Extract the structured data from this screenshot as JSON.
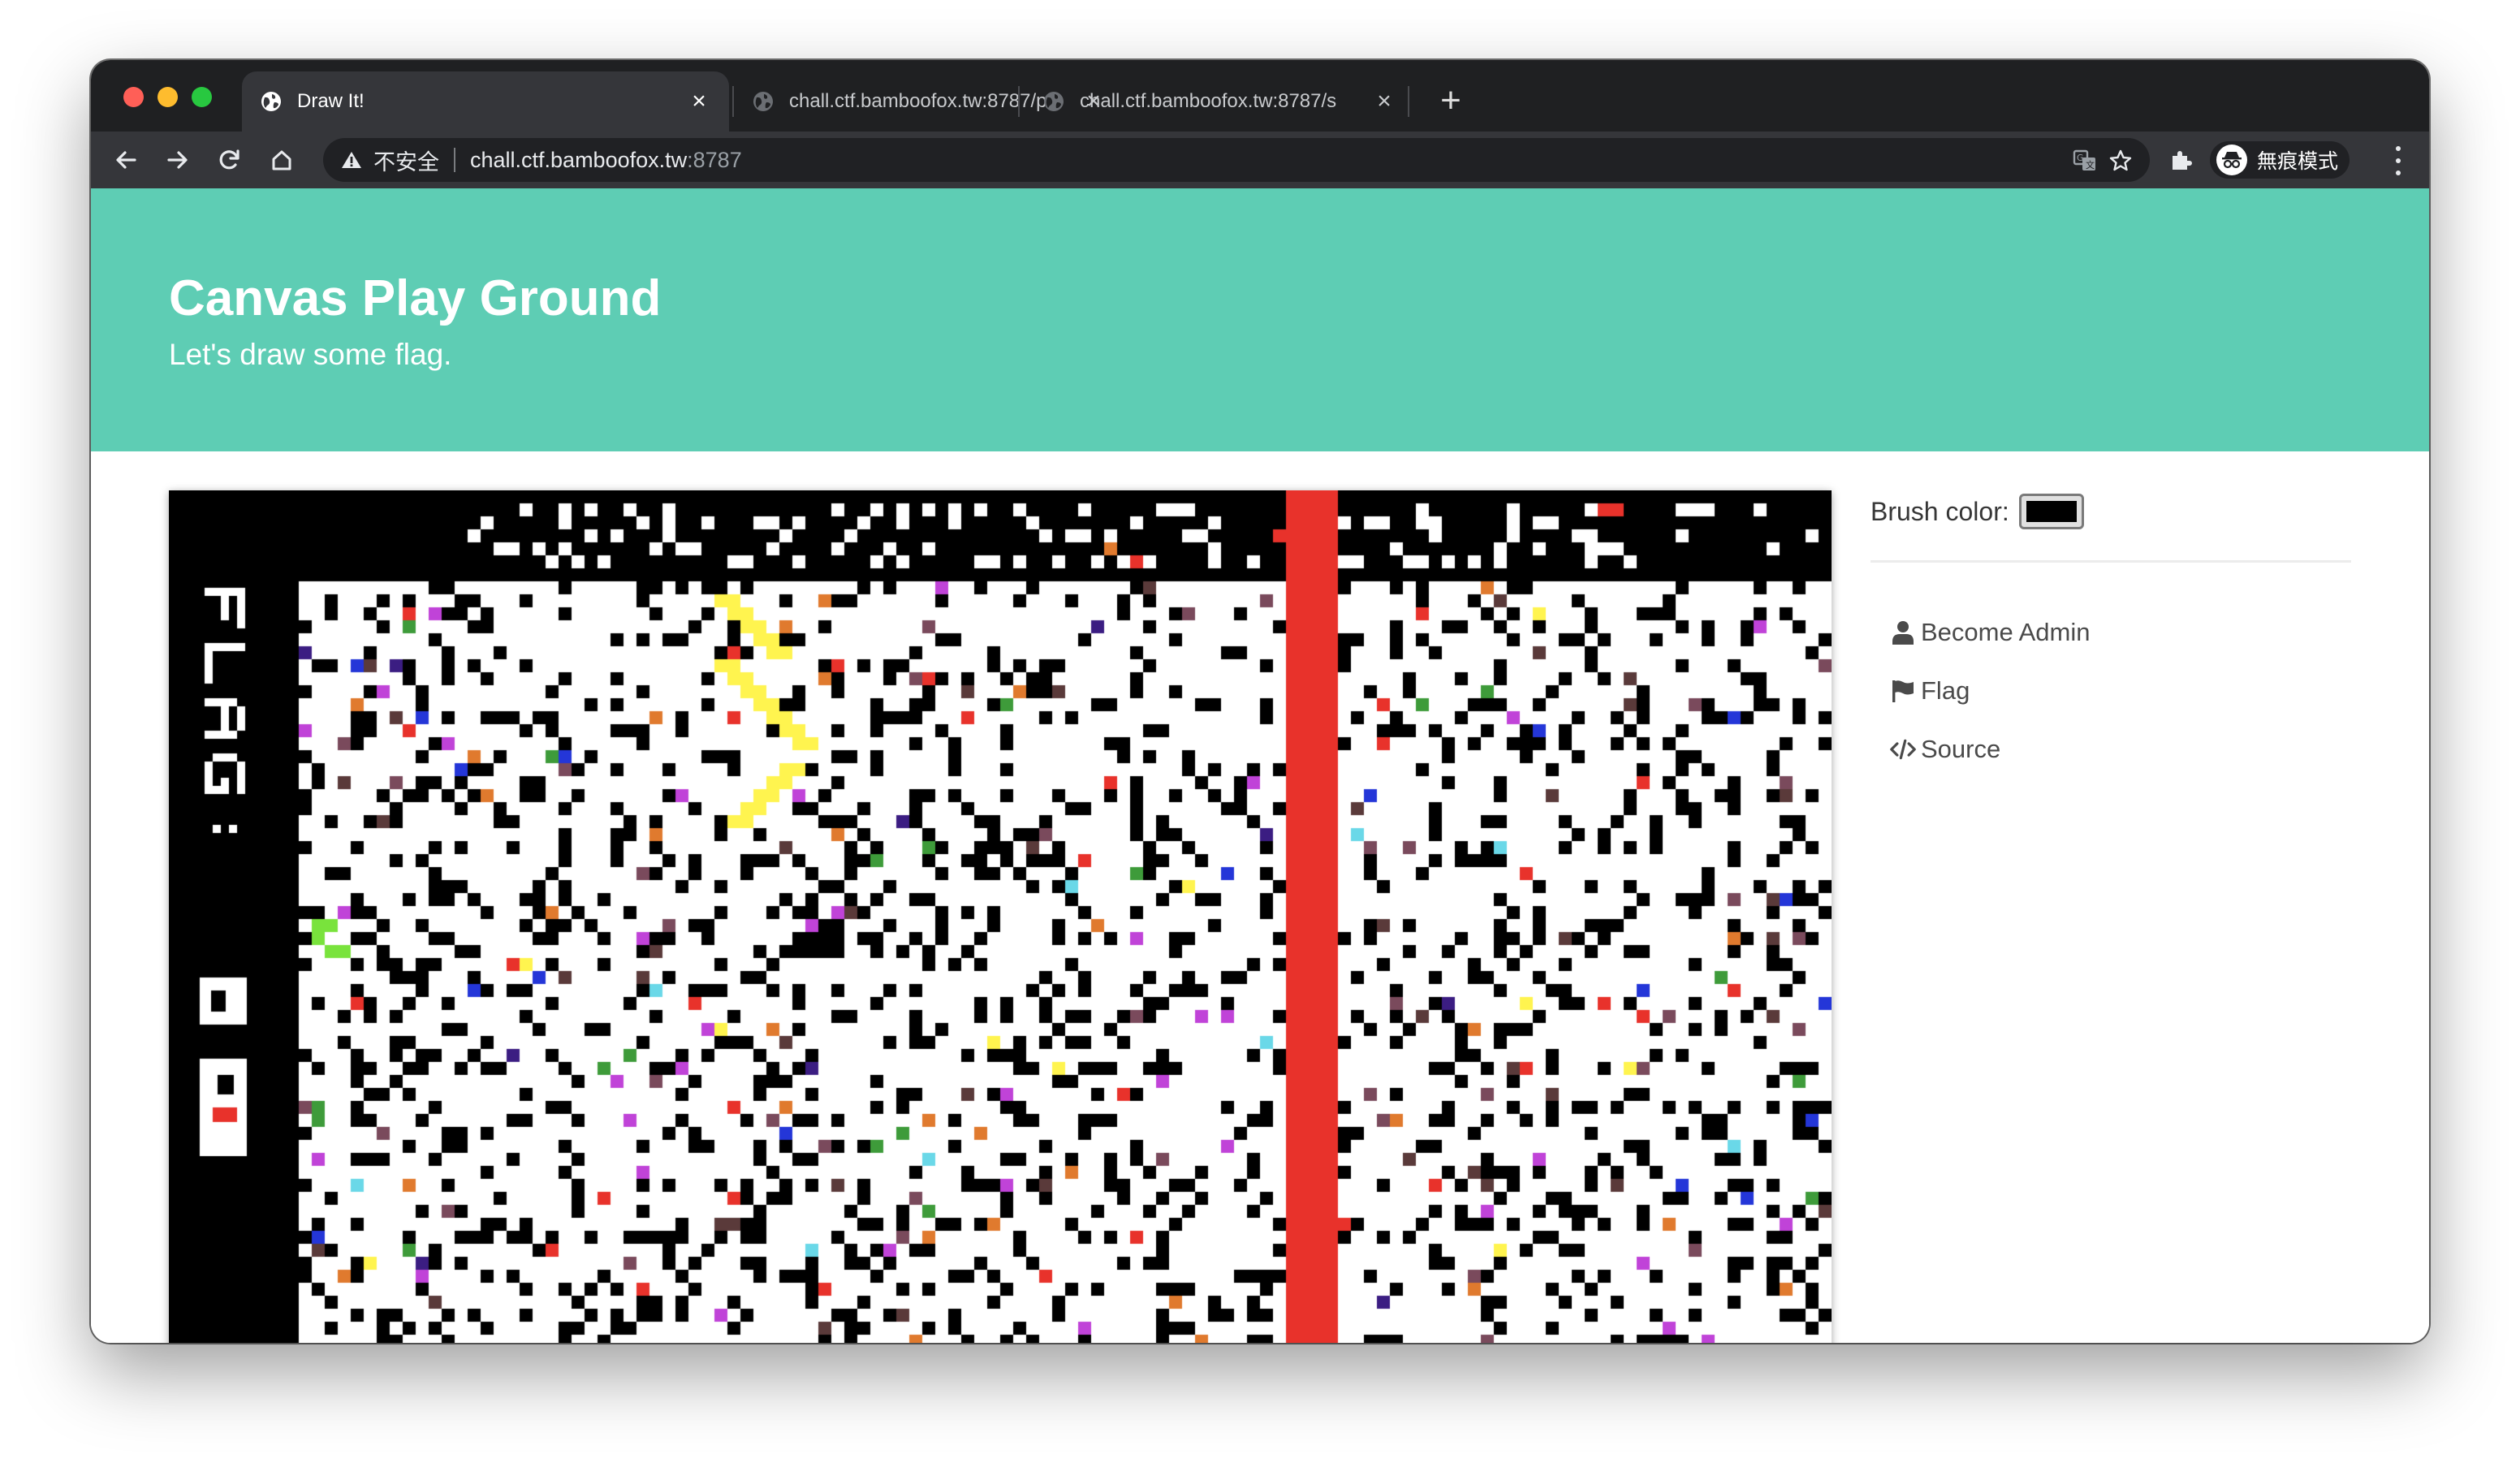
{
  "browser": {
    "tabs": [
      {
        "title": "Draw It!",
        "active": true
      },
      {
        "title": "chall.ctf.bamboofox.tw:8787/p",
        "active": false
      },
      {
        "title": "chall.ctf.bamboofox.tw:8787/s",
        "active": false
      }
    ],
    "new_tab_label": "+",
    "omnibox": {
      "security_label": "不安全",
      "host": "chall.ctf.bamboofox.tw",
      "port": ":8787"
    },
    "profile_label": "無痕模式"
  },
  "page": {
    "hero": {
      "title": "Canvas Play Ground",
      "subtitle": "Let's draw some flag."
    },
    "brush": {
      "label": "Brush color:",
      "color": "#000000"
    },
    "menu": [
      {
        "label": "Become Admin",
        "icon": "user-icon"
      },
      {
        "label": "Flag",
        "icon": "flag-icon"
      },
      {
        "label": "Source",
        "icon": "code-icon"
      }
    ],
    "canvas": {
      "text": "FLAG:",
      "palette": {
        "red": "#e8322b",
        "black": "#000000",
        "yellow": "#fff44f",
        "purple": "#3b1d82",
        "magenta": "#c043d8",
        "green": "#3e9b3a",
        "lime": "#79e33c",
        "orange": "#e07a2e",
        "blue": "#2436d8",
        "cyan": "#6ad8e8",
        "mauve": "#7a4a5c",
        "brown": "#5a3a3a"
      }
    },
    "accent_color": "#5ecdb4"
  }
}
